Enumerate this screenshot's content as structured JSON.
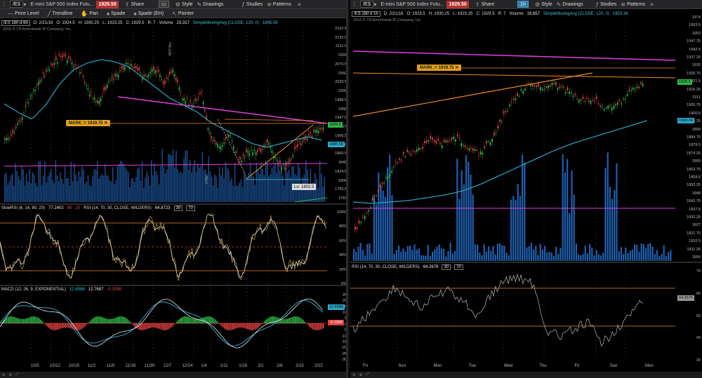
{
  "left": {
    "symbol": "/ES",
    "description": "E-mini S&P 500 Index Futu...",
    "last_price": "1929.50",
    "toolbar1": {
      "share": "Share",
      "style": "Style",
      "drawings": "Drawings",
      "studies": "Studies",
      "patterns": "Patterns"
    },
    "toolbar2": [
      "Price Level",
      "Trendline",
      "Pan",
      "Spade",
      "Spade (EH)",
      "Pointer"
    ],
    "info": {
      "symbol": "/ES 180 d 6h",
      "date": "D: 2/21/16",
      "open": "O: 1924.5",
      "high": "H: 1930.25",
      "low": "L: 1923.25",
      "close": "C: 1929.5",
      "range": "R: 7",
      "volume": "Volume",
      "volume_val": "23,317",
      "sma": "SimpleMovingAvg (CLOSE, 120, 0)",
      "sma_val": "1885.59"
    },
    "copyright": "2016 © TD Ameritrade IP Company, Inc.",
    "price_axis": [
      "2152.5",
      "2132.5",
      "2111.5",
      "2091",
      "2070.5",
      "2050",
      "2029.5",
      "2009",
      "1988.5",
      "1968",
      "1947.5",
      "1927",
      "1906.5",
      "1886",
      "1865.5",
      "1845",
      "1824.5",
      "1804",
      "1783.5",
      "1763"
    ],
    "mark": "MARK := 1939.75",
    "price_tag": "1929.5",
    "sma_tag": "1885.59",
    "lo": "Lo: 1802.5",
    "vol_labels": [
      "NFP Mix",
      "VTAV"
    ],
    "slow_rsi": {
      "label": "SlowRSI (6, 14, 80, 20)",
      "val1": "77.2402",
      "val2": "80",
      "val3": "20",
      "rsi": "RSI (14, 70, 30, CLOSE, WILDERS)",
      "rsi_val": "64.8723",
      "v30": "30",
      "v70": "70",
      "axis": [
        "100%",
        "80%",
        "60%",
        "40%",
        "20%",
        "0%"
      ]
    },
    "macd": {
      "label": "MACD (12, 26, 9, EXPONENTIAL)",
      "val1": "12.6588",
      "val2": "12.7687",
      "val3": "-0.1098",
      "tag": "12.6588",
      "tag2": "-0.1098",
      "axis": [
        "25",
        "20",
        "15",
        "10",
        "5",
        "0",
        "-5",
        "-10",
        "-15",
        "-20",
        "-25",
        "-30"
      ]
    },
    "xaxis": [
      "10/5",
      "10/12",
      "10/19",
      "11/2",
      "11/9",
      "11/16",
      "11/30",
      "12/7",
      "12/14",
      "1/4",
      "1/11",
      "1/18",
      "2/1",
      "2/8",
      "2/15",
      "2/22"
    ]
  },
  "right": {
    "symbol": "/ES",
    "description": "E-mini S&P 500 Index Futu...",
    "last_price": "1929.50",
    "toolbar1": {
      "share": "Share",
      "period": "1h",
      "style": "Style",
      "drawings": "Drawings",
      "studies": "Studies",
      "patterns": "Patterns"
    },
    "info": {
      "symbol": "/ES 180 d 1h",
      "date": "D: 2/21/16",
      "open": "O: 1923.5",
      "high": "H: 1930.25",
      "low": "L: 1923.25",
      "close": "C: 1929.5",
      "range": "R: 7",
      "volume": "Volume",
      "volume_val": "19,657",
      "sma": "SimpleMovingAvg (CLOSE, 120, 0)",
      "sma_val": "1903.34"
    },
    "copyright": "2016 © TD Ameritrade IP Company, Inc.",
    "price_axis": [
      "1974",
      "1963.5",
      "1953",
      "1947.75",
      "1942.5",
      "1937.25",
      "1932",
      "1926.75",
      "1921.5",
      "1916.25",
      "1911",
      "1905.75",
      "1900.5",
      "1895.25",
      "1890",
      "1884.75",
      "1879.5",
      "1874.25",
      "1869",
      "1863.75",
      "1858.5",
      "1853.25",
      "1848",
      "1842.75",
      "1837.5",
      "1832.25",
      "1827",
      "1821.75",
      "1816.5",
      "1811.25",
      "1806"
    ],
    "mark": "MARK := 1939.75",
    "price_tag": "1929.5",
    "sma_tag": "1903.34",
    "rsi": {
      "label": "RSI (14, 70, 30, CLOSE, WILDERS)",
      "val": "64.2676",
      "v30": "30",
      "v70": "70",
      "axis": [
        "70",
        "60",
        "50",
        "40",
        "30"
      ],
      "tag": "64.2676"
    },
    "xaxis": [
      "Fri",
      "Sun",
      "Mon",
      "Tue",
      "Wed",
      "Thu",
      "Fri",
      "Sun",
      "Mon"
    ]
  },
  "colors": {
    "up": "#2fb84a",
    "down": "#e04040",
    "sma": "#2aa7c9",
    "magenta": "#e040e0",
    "orange": "#f08a24",
    "volume": "#1f5fb0",
    "mark": "#e0a020"
  }
}
